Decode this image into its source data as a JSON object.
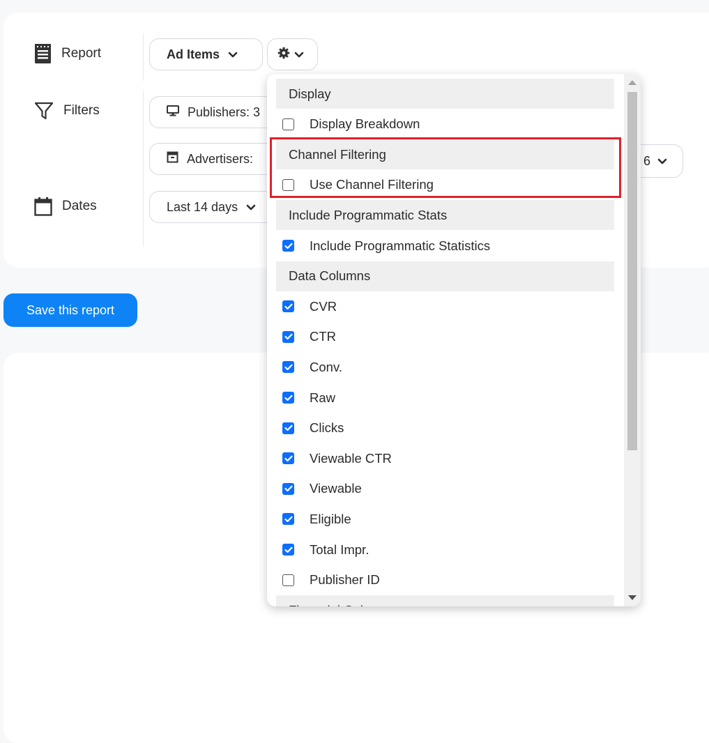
{
  "colors": {
    "accent": "#0d83f5",
    "checkbox": "#0d6efd",
    "highlight": "#e0202a"
  },
  "labels": {
    "report": "Report",
    "filters": "Filters",
    "dates": "Dates"
  },
  "report_select": {
    "value": "Ad Items",
    "settings_icon": "gear-icon"
  },
  "filters": {
    "publishers": "Publishers: 3",
    "advertisers": "Advertisers:",
    "advertisers_suffix": "6"
  },
  "dates": {
    "range": "Last 14 days"
  },
  "save_button": "Save this report",
  "dropdown": {
    "sections": [
      {
        "header": "Display",
        "items": [
          {
            "label": "Display Breakdown",
            "checked": false
          }
        ]
      },
      {
        "header": "Channel Filtering",
        "items": [
          {
            "label": "Use Channel Filtering",
            "checked": false
          }
        ]
      },
      {
        "header": "Include Programmatic Stats",
        "items": [
          {
            "label": "Include Programmatic Statistics",
            "checked": true
          }
        ]
      },
      {
        "header": "Data Columns",
        "items": [
          {
            "label": "CVR",
            "checked": true
          },
          {
            "label": "CTR",
            "checked": true
          },
          {
            "label": "Conv.",
            "checked": true
          },
          {
            "label": "Raw",
            "checked": true
          },
          {
            "label": "Clicks",
            "checked": true
          },
          {
            "label": "Viewable CTR",
            "checked": true
          },
          {
            "label": "Viewable",
            "checked": true
          },
          {
            "label": "Eligible",
            "checked": true
          },
          {
            "label": "Total Impr.",
            "checked": true
          },
          {
            "label": "Publisher ID",
            "checked": false
          }
        ]
      },
      {
        "header": "Financial Columns",
        "items": []
      }
    ]
  }
}
